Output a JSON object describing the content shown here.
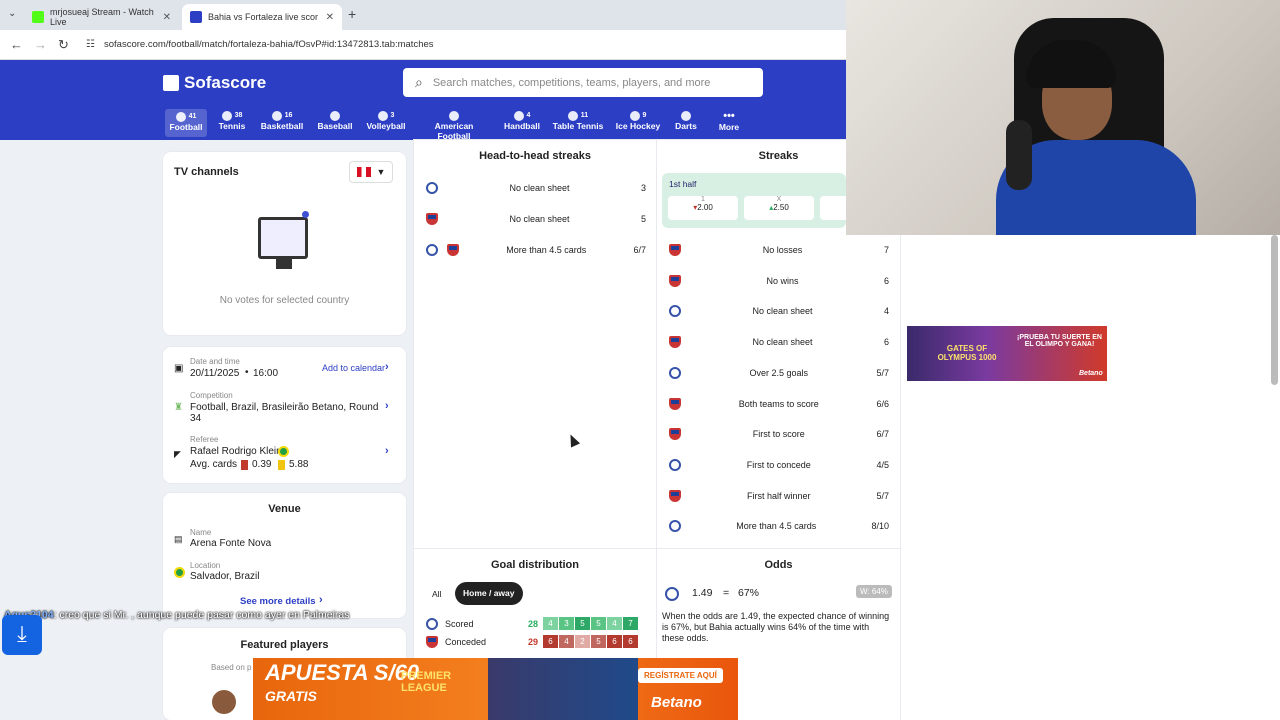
{
  "browser": {
    "tabs": [
      {
        "title": "mrjosueaj Stream - Watch Live"
      },
      {
        "title": "Bahia vs Fortaleza live score, H..."
      }
    ],
    "url": "sofascore.com/football/match/fortaleza-bahia/fOsvP#id:13472813.tab:matches"
  },
  "header": {
    "logo": "Sofascore",
    "search_placeholder": "Search matches, competitions, teams, players, and more",
    "sports": [
      {
        "label": "Football",
        "count": "41"
      },
      {
        "label": "Tennis",
        "count": "38"
      },
      {
        "label": "Basketball",
        "count": "16"
      },
      {
        "label": "Baseball",
        "count": ""
      },
      {
        "label": "Volleyball",
        "count": "3"
      },
      {
        "label": "American Football",
        "count": ""
      },
      {
        "label": "Handball",
        "count": "4"
      },
      {
        "label": "Table Tennis",
        "count": "11"
      },
      {
        "label": "Ice Hockey",
        "count": "9"
      },
      {
        "label": "Darts",
        "count": ""
      },
      {
        "label": "More",
        "count": ""
      }
    ]
  },
  "tv": {
    "title": "TV channels",
    "no_votes": "No votes for selected country"
  },
  "details": {
    "date_label": "Date and time",
    "date_value": "20/11/2025",
    "time_value": "16:00",
    "add_calendar": "Add to calendar",
    "competition_label": "Competition",
    "competition_value": "Football, Brazil, Brasileirão Betano, Round 34",
    "referee_label": "Referee",
    "referee_name": "Rafael Rodrigo Klein",
    "avg_cards_label": "Avg. cards",
    "avg_red": "0.39",
    "avg_yellow": "5.88"
  },
  "venue": {
    "title": "Venue",
    "name_label": "Name",
    "name_value": "Arena Fonte Nova",
    "location_label": "Location",
    "location_value": "Salvador, Brazil",
    "see_more": "See more details"
  },
  "featured": {
    "title": "Featured players",
    "based_on": "Based on p"
  },
  "h2h": {
    "title": "Head-to-head streaks",
    "rows": [
      {
        "label": "No clean sheet",
        "value": "3"
      },
      {
        "label": "No clean sheet",
        "value": "5"
      },
      {
        "label": "More than 4.5 cards",
        "value": "6/7"
      }
    ]
  },
  "streaks": {
    "title": "Streaks",
    "half_label": "1st half",
    "odds": [
      {
        "label": "1",
        "value": "2.00"
      },
      {
        "label": "X",
        "value": "2.50"
      }
    ],
    "rows": [
      {
        "label": "No losses",
        "value": "7"
      },
      {
        "label": "No wins",
        "value": "6"
      },
      {
        "label": "No clean sheet",
        "value": "4"
      },
      {
        "label": "No clean sheet",
        "value": "6"
      },
      {
        "label": "Over 2.5 goals",
        "value": "5/7"
      },
      {
        "label": "Both teams to score",
        "value": "6/6"
      },
      {
        "label": "First to score",
        "value": "6/7"
      },
      {
        "label": "First to concede",
        "value": "4/5"
      },
      {
        "label": "First half winner",
        "value": "5/7"
      },
      {
        "label": "More than 4.5 cards",
        "value": "8/10"
      }
    ]
  },
  "goal_distribution": {
    "title": "Goal distribution",
    "filter_all": "All",
    "filter_home_away": "Home / away",
    "scored_label": "Scored",
    "scored_total": "28",
    "scored_boxes": [
      "4",
      "3",
      "5",
      "5",
      "4",
      "7"
    ],
    "conceded_label": "Conceded",
    "conceded_total": "29",
    "conceded_boxes": [
      "6",
      "4",
      "2",
      "5",
      "6",
      "6"
    ]
  },
  "odds_card": {
    "title": "Odds",
    "odd": "1.49",
    "eq": "=",
    "pct": "67%",
    "badge": "W: 64%",
    "text": "When the odds are 1.49, the expected chance of winning is 67%, but Bahia actually wins 64% of the time with these odds."
  },
  "overlay": {
    "chat_user": "Agus2104",
    "chat_msg": ": creo que si Mr. , aunque puede pasar como ayer en Palmeiras",
    "ad_bottom_line1": "APUESTA S/60",
    "ad_bottom_line2": "GRATIS",
    "ad_bottom_cta": "REGÍSTRATE AQUÍ",
    "ad_bottom_brand": "Betano",
    "ad_bottom_league": "PREMIER LEAGUE",
    "ad_right_text": "¡PRUEBA TU SUERTE EN EL OLIMPO Y GANA!",
    "ad_right_game": "GATES OF OLYMPUS 1000",
    "ad_right_brand": "Betano"
  },
  "colors": {
    "brand": "#2c3ec4",
    "green": "#2ecc71",
    "red": "#c0392b"
  }
}
